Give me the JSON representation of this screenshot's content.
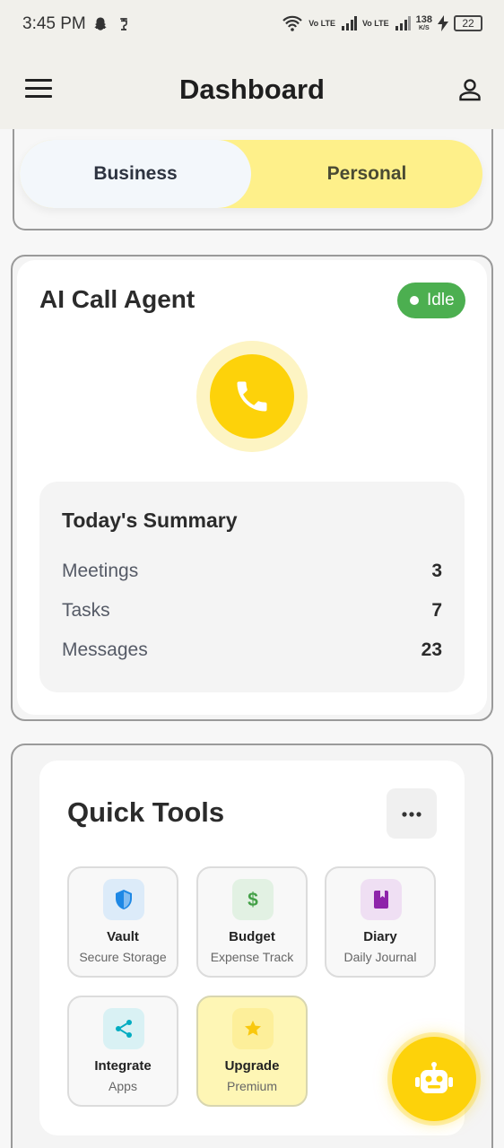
{
  "status_bar": {
    "time": "3:45 PM",
    "network_label_1": "Vo LTE",
    "network_label_2": "Vo LTE",
    "speed": "138",
    "speed_unit": "K/S",
    "battery": "22"
  },
  "app_bar": {
    "title": "Dashboard",
    "menu_icon": "hamburger-menu-icon",
    "profile_icon": "user-profile-icon"
  },
  "mode_toggle": {
    "options": [
      "Business",
      "Personal"
    ],
    "selected": "Business",
    "colors": {
      "business_bg": "#f3f7fb",
      "personal_bg": "#fef08a"
    }
  },
  "agent_card": {
    "title": "AI Call Agent",
    "status": "Idle",
    "status_color": "#4caf50",
    "call_icon": "phone-icon",
    "accent": "#fdd20a",
    "summary": {
      "title": "Today's Summary",
      "rows": [
        {
          "label": "Meetings",
          "value": "3"
        },
        {
          "label": "Tasks",
          "value": "7"
        },
        {
          "label": "Messages",
          "value": "23"
        }
      ]
    }
  },
  "tools_card": {
    "title": "Quick Tools",
    "more_icon": "more-horizontal-icon",
    "tools": [
      {
        "name": "Vault",
        "subtitle": "Secure Storage",
        "icon": "shield-icon",
        "icon_color": "#1e88e5",
        "icon_bg": "#dcebf9"
      },
      {
        "name": "Budget",
        "subtitle": "Expense Track",
        "icon": "dollar-icon",
        "icon_color": "#43a047",
        "icon_bg": "#e2f1e3"
      },
      {
        "name": "Diary",
        "subtitle": "Daily Journal",
        "icon": "book-icon",
        "icon_color": "#8e24aa",
        "icon_bg": "#efdff3"
      },
      {
        "name": "Integrate",
        "subtitle": "Apps",
        "icon": "share-icon",
        "icon_color": "#00acc1",
        "icon_bg": "#d9f1f4"
      },
      {
        "name": "Upgrade",
        "subtitle": "Premium",
        "icon": "star-icon",
        "icon_color": "#f9c80e",
        "icon_bg": "#fdef9a"
      }
    ]
  },
  "fab": {
    "icon": "robot-icon"
  }
}
